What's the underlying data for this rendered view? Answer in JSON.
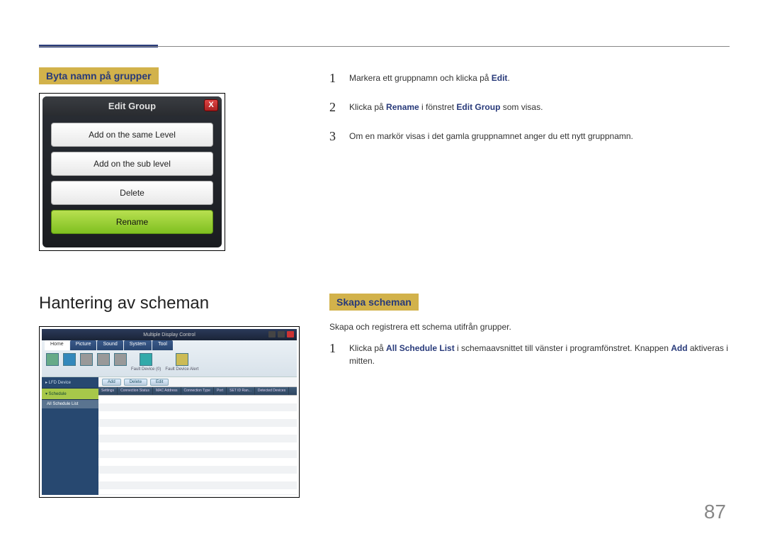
{
  "page_number": "87",
  "section1": {
    "label": "Byta namn på grupper",
    "dialog": {
      "title": "Edit Group",
      "close": "X",
      "buttons": [
        "Add on the same Level",
        "Add on the sub level",
        "Delete",
        "Rename"
      ]
    },
    "steps": [
      {
        "num": "1",
        "pre": "Markera ett gruppnamn och klicka på ",
        "kw": "Edit",
        "post": "."
      },
      {
        "num": "2",
        "pre": "Klicka på ",
        "kw": "Rename",
        "mid": " i fönstret ",
        "kw2": "Edit Group",
        "post": " som visas."
      },
      {
        "num": "3",
        "pre": "Om en markör visas i det gamla gruppnamnet anger du ett nytt gruppnamn."
      }
    ]
  },
  "section2": {
    "heading": "Hantering av scheman",
    "label": "Skapa scheman",
    "desc": "Skapa och registrera ett schema utifrån grupper.",
    "steps": [
      {
        "num": "1",
        "pre": "Klicka på ",
        "kw": "All Schedule List",
        "mid": " i schemaavsnittet till vänster i programfönstret. Knappen ",
        "kw2": "Add",
        "post": " aktiveras i mitten."
      }
    ],
    "app": {
      "title": "Multiple Display Control",
      "tabs": [
        "Home",
        "Picture",
        "Sound",
        "System",
        "Tool"
      ],
      "ribbon": [
        {
          "label": ""
        },
        {
          "label": ""
        },
        {
          "label": ""
        },
        {
          "label": ""
        },
        {
          "label": ""
        },
        {
          "label": "Fault Device (0)"
        },
        {
          "label": "Fault Device Alert"
        }
      ],
      "side": [
        {
          "label": "▸ LFD Device",
          "type": "item"
        },
        {
          "label": "▾ Schedule",
          "type": "sel"
        },
        {
          "label": "All Schedule List",
          "type": "sub"
        }
      ],
      "toolbar_buttons": [
        "Add",
        "Delete",
        "Edit"
      ],
      "grid_headers": [
        "Settings",
        "Connection Status",
        "MAC Address",
        "Connection Type",
        "Port",
        "SET ID Ran...",
        "Detected Devices"
      ]
    }
  }
}
